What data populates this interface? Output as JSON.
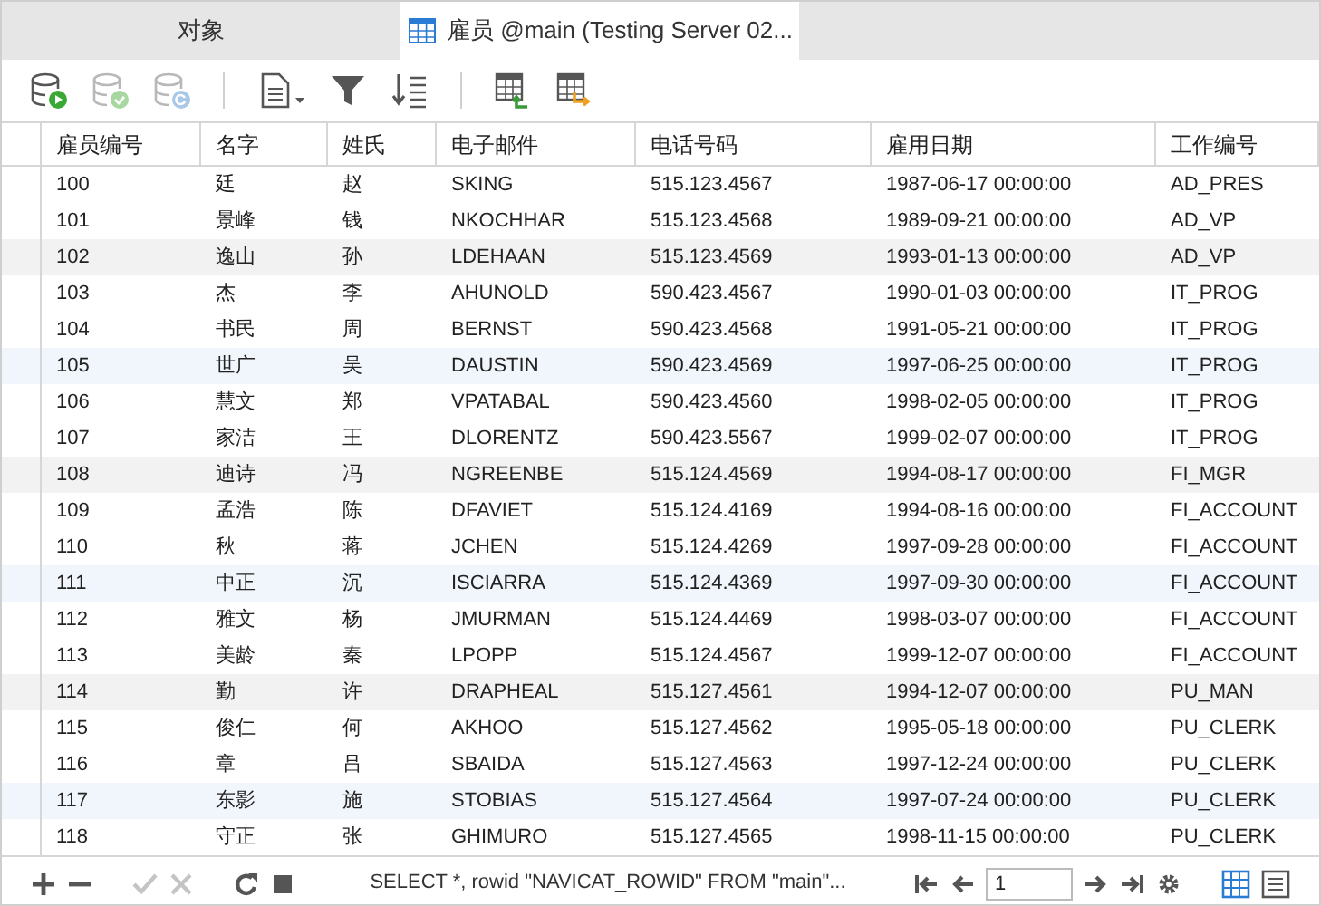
{
  "tabs": [
    {
      "label": "对象",
      "selected": false,
      "kind": "plain"
    },
    {
      "label": "雇员 @main (Testing Server 02...",
      "selected": true,
      "kind": "table"
    }
  ],
  "toolbar": [
    {
      "kind": "db-run",
      "disabled": false
    },
    {
      "kind": "db-check",
      "disabled": true
    },
    {
      "kind": "db-refresh",
      "disabled": true
    },
    {
      "kind": "sep"
    },
    {
      "kind": "document",
      "disabled": false
    },
    {
      "kind": "filter",
      "disabled": false
    },
    {
      "kind": "sort",
      "disabled": false
    },
    {
      "kind": "sep"
    },
    {
      "kind": "import",
      "disabled": false
    },
    {
      "kind": "export",
      "disabled": false
    }
  ],
  "table": {
    "columns": [
      "雇员编号",
      "名字",
      "姓氏",
      "电子邮件",
      "电话号码",
      "雇用日期",
      "工作编号"
    ],
    "rows": [
      [
        "100",
        "廷",
        "赵",
        "SKING",
        "515.123.4567",
        "1987-06-17 00:00:00",
        "AD_PRES"
      ],
      [
        "101",
        "景峰",
        "钱",
        "NKOCHHAR",
        "515.123.4568",
        "1989-09-21 00:00:00",
        "AD_VP"
      ],
      [
        "102",
        "逸山",
        "孙",
        "LDEHAAN",
        "515.123.4569",
        "1993-01-13 00:00:00",
        "AD_VP"
      ],
      [
        "103",
        "杰",
        "李",
        "AHUNOLD",
        "590.423.4567",
        "1990-01-03 00:00:00",
        "IT_PROG"
      ],
      [
        "104",
        "书民",
        "周",
        "BERNST",
        "590.423.4568",
        "1991-05-21 00:00:00",
        "IT_PROG"
      ],
      [
        "105",
        "世广",
        "吴",
        "DAUSTIN",
        "590.423.4569",
        "1997-06-25 00:00:00",
        "IT_PROG"
      ],
      [
        "106",
        "慧文",
        "郑",
        "VPATABAL",
        "590.423.4560",
        "1998-02-05 00:00:00",
        "IT_PROG"
      ],
      [
        "107",
        "家洁",
        "王",
        "DLORENTZ",
        "590.423.5567",
        "1999-02-07 00:00:00",
        "IT_PROG"
      ],
      [
        "108",
        "迪诗",
        "冯",
        "NGREENBE",
        "515.124.4569",
        "1994-08-17 00:00:00",
        "FI_MGR"
      ],
      [
        "109",
        "孟浩",
        "陈",
        "DFAVIET",
        "515.124.4169",
        "1994-08-16 00:00:00",
        "FI_ACCOUNT"
      ],
      [
        "110",
        "秋",
        "蒋",
        "JCHEN",
        "515.124.4269",
        "1997-09-28 00:00:00",
        "FI_ACCOUNT"
      ],
      [
        "111",
        "中正",
        "沉",
        "ISCIARRA",
        "515.124.4369",
        "1997-09-30 00:00:00",
        "FI_ACCOUNT"
      ],
      [
        "112",
        "雅文",
        "杨",
        "JMURMAN",
        "515.124.4469",
        "1998-03-07 00:00:00",
        "FI_ACCOUNT"
      ],
      [
        "113",
        "美龄",
        "秦",
        "LPOPP",
        "515.124.4567",
        "1999-12-07 00:00:00",
        "FI_ACCOUNT"
      ],
      [
        "114",
        "勤",
        "许",
        "DRAPHEAL",
        "515.127.4561",
        "1994-12-07 00:00:00",
        "PU_MAN"
      ],
      [
        "115",
        "俊仁",
        "何",
        "AKHOO",
        "515.127.4562",
        "1995-05-18 00:00:00",
        "PU_CLERK"
      ],
      [
        "116",
        "章",
        "吕",
        "SBAIDA",
        "515.127.4563",
        "1997-12-24 00:00:00",
        "PU_CLERK"
      ],
      [
        "117",
        "东影",
        "施",
        "STOBIAS",
        "515.127.4564",
        "1997-07-24 00:00:00",
        "PU_CLERK"
      ],
      [
        "118",
        "守正",
        "张",
        "GHIMURO",
        "515.127.4565",
        "1998-11-15 00:00:00",
        "PU_CLERK"
      ]
    ]
  },
  "bottom": {
    "actions": [
      {
        "kind": "add",
        "disabled": false
      },
      {
        "kind": "remove",
        "disabled": false
      },
      {
        "kind": "sep"
      },
      {
        "kind": "apply",
        "disabled": true
      },
      {
        "kind": "discard",
        "disabled": true
      },
      {
        "kind": "sep"
      },
      {
        "kind": "refresh",
        "disabled": false
      },
      {
        "kind": "stop",
        "disabled": false
      }
    ],
    "sql": "SELECT *, rowid \"NAVICAT_ROWID\" FROM \"main\"...",
    "page": "1",
    "views": [
      {
        "kind": "grid",
        "selected": true
      },
      {
        "kind": "form",
        "selected": false
      }
    ]
  }
}
